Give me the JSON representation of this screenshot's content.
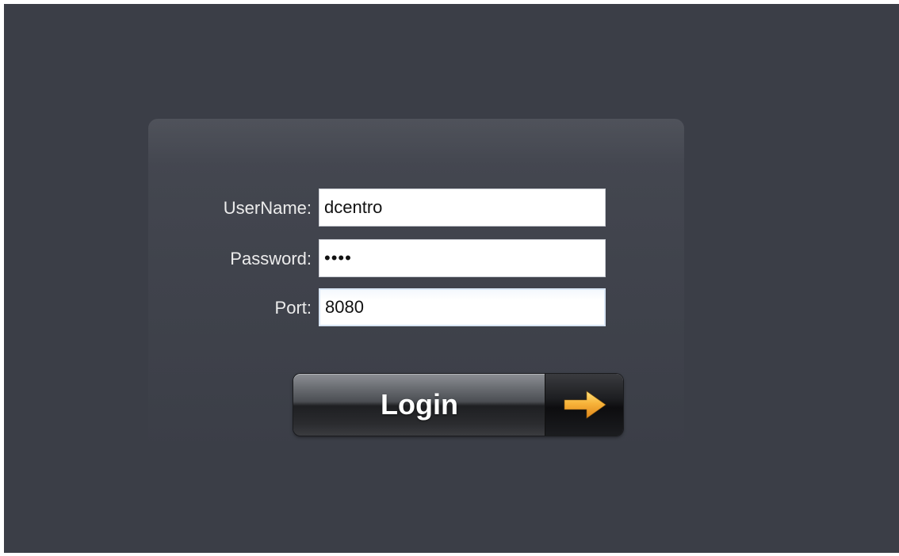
{
  "form": {
    "username_label": "UserName:",
    "username_value": "dcentro",
    "password_label": "Password:",
    "password_value": "••••",
    "port_label": "Port:",
    "port_value": "8080"
  },
  "login_button": {
    "label": "Login",
    "icon": "arrow-right-icon"
  },
  "colors": {
    "background": "#3b3e47",
    "arrow": "#f5a623"
  }
}
